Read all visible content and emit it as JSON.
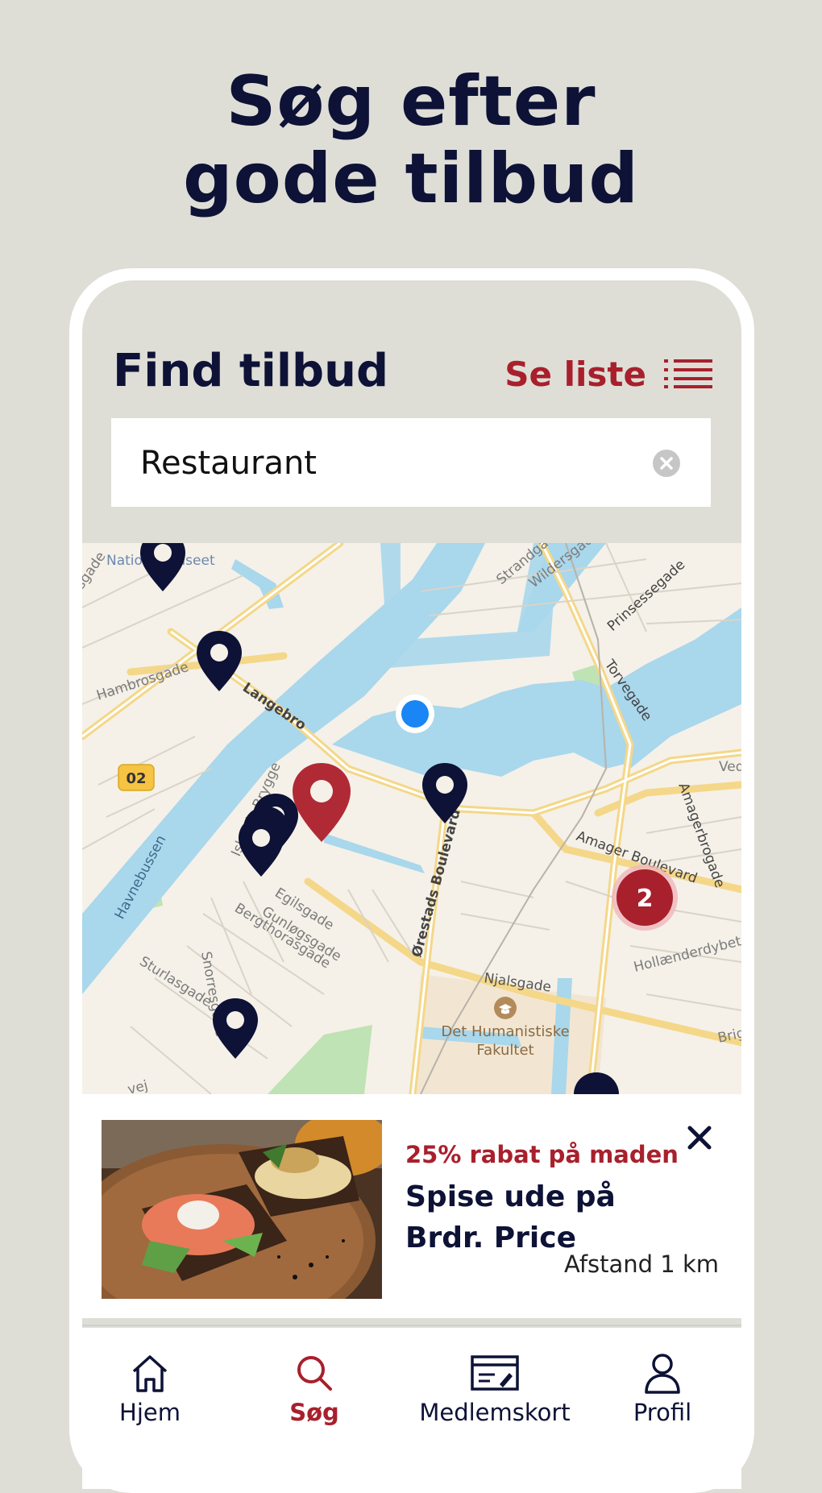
{
  "headline": {
    "line1": "Søg efter",
    "line2": "gode tilbud"
  },
  "header": {
    "title": "Find tilbud",
    "list_link": "Se liste"
  },
  "search": {
    "value": "Restaurant"
  },
  "map": {
    "labels": {
      "nationalmuseet": "Nationalmuseet",
      "hambrosgade": "Hambrosgade",
      "langebro": "Langebro",
      "route": "02",
      "islands_brygge": "Islands Brygge",
      "havnebussen": "Havnebussen",
      "strandgade": "Strandgade",
      "wildersgade": "Wildersgade",
      "prinsessegade": "Prinsessegade",
      "torvegade": "Torvegade",
      "amagerbrogade": "Amagerbrogade",
      "amager_boulevard": "Amager Boulevard",
      "orestads_boulevard": "Ørestads Boulevard",
      "njalsgade": "Njalsgade",
      "hollaenderdybet": "Hollænderdybet",
      "snorresgade": "Snorresgade",
      "sturlasgade": "Sturlasgade",
      "egilsgade": "Egilsgade",
      "gunloegsgade": "Gunløgsgade",
      "bergthorasgade": "Bergthorasgade",
      "university_line1": "Det Humanistiske",
      "university_line2": "Fakultet",
      "islandsbrygge_gade": "sgade",
      "ved": "Ved",
      "brig": "Brig",
      "vej": "vej"
    },
    "cluster_count": "2",
    "colors": {
      "water": "#a9d7ec",
      "pin": "#0d1236",
      "selected_pin": "#b02a35",
      "user": "#1a85f5"
    }
  },
  "card": {
    "discount": "25% rabat på maden",
    "title": "Spise ude på Brdr. Price",
    "distance": "Afstand 1 km"
  },
  "nav": {
    "items": [
      {
        "label": "Hjem",
        "icon": "home-icon"
      },
      {
        "label": "Søg",
        "icon": "search-icon"
      },
      {
        "label": "Medlemskort",
        "icon": "card-icon"
      },
      {
        "label": "Profil",
        "icon": "person-icon"
      }
    ]
  },
  "colors": {
    "navy": "#0d1236",
    "brand_red": "#a8202c",
    "background": "#deded7"
  }
}
